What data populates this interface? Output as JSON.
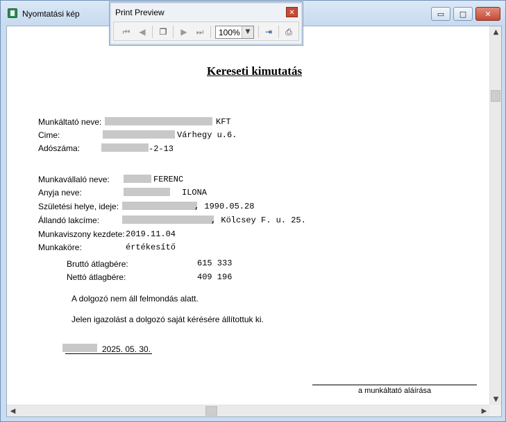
{
  "window": {
    "title": "Nyomtatási kép",
    "controls": {
      "minimize": "▭",
      "maximize": "□",
      "close": "✕"
    }
  },
  "print_preview": {
    "title": "Print Preview",
    "close": "✕",
    "zoom": "100%",
    "icons": [
      "first-page-icon",
      "prev-page-icon",
      "multi-page-icon",
      "next-page-icon",
      "last-page-icon",
      "exit-icon",
      "print-icon"
    ]
  },
  "document": {
    "title": "Kereseti kimutatás",
    "employer_label": "Munkáltató neve:",
    "employer_value": "KFT",
    "address_label": "Cime:",
    "address_value": "Várhegy u.6.",
    "tax_label": "Adószáma:",
    "tax_value": "-2-13",
    "employee_label": "Munkavállaló neve:",
    "employee_value": "FERENC",
    "mother_label": "Anyja neve:",
    "mother_value": "ILONA",
    "birth_label": "Születési helye, ideje:",
    "birth_value": ", 1990.05.28",
    "residence_label": "Állandó lakcíme:",
    "residence_value": ", Kölcsey F. u. 25.",
    "start_label": "Munkaviszony kezdete:",
    "start_value": "2019.11.04",
    "job_label": "Munkaköre:",
    "job_value": "értékesítő",
    "gross_label": "Bruttó átlagbére:",
    "gross_value": "615 333",
    "net_label": "Nettó átlagbére:",
    "net_value": "409 196",
    "statement1": "A dolgozó nem áll felmondás alatt.",
    "statement2": "Jelen igazolást a dolgozó saját kérésére állítottuk ki.",
    "date": "2025. 05. 30.",
    "signature_label": "a munkáltató aláírása"
  }
}
